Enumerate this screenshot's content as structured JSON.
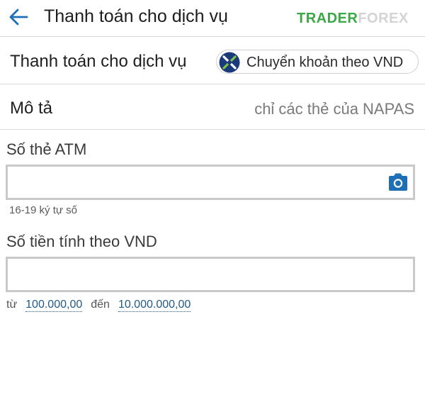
{
  "header": {
    "title": "Thanh toán cho dịch vụ",
    "watermark_part1": "TRADER",
    "watermark_part2": "FOREX",
    "back_icon": "arrow-left-icon"
  },
  "service_row": {
    "label": "Thanh toán cho dịch vụ",
    "selected_service": "Chuyển khoản theo VND",
    "logo_icon": "napas-logo-icon"
  },
  "description_row": {
    "label": "Mô tả",
    "value": "chỉ các thẻ của NAPAS"
  },
  "card_field": {
    "label": "Số thẻ ATM",
    "value": "",
    "placeholder": "",
    "hint": "16-19 ký tự số",
    "camera_icon": "camera-icon"
  },
  "amount_field": {
    "label": "Số tiền tính theo VND",
    "value": "",
    "placeholder": "",
    "range_from_word": "từ",
    "range_min": "100.000,00",
    "range_to_word": "đến",
    "range_max": "10.000.000,00"
  },
  "colors": {
    "accent_blue": "#1e6fb5",
    "link_blue": "#1f5a8a",
    "watermark_green": "#3aa845",
    "border_gray": "#c9c9c9"
  }
}
